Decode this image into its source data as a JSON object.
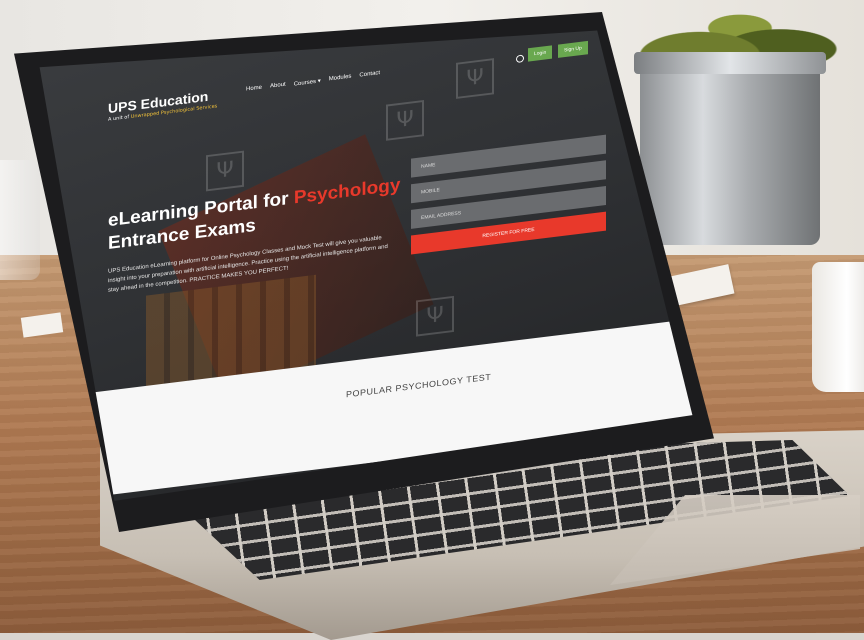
{
  "brand": {
    "title": "UPS Education",
    "sub_prefix": "A unit of",
    "sub_accent": "Unwrapped Psychological Services"
  },
  "nav": {
    "items": [
      "Home",
      "About",
      "Courses ▾",
      "Modules",
      "Contact"
    ]
  },
  "header_buttons": {
    "login": "Login",
    "signup": "Sign Up"
  },
  "hero": {
    "title_prefix": "eLearning Portal for",
    "title_accent": "Psychology",
    "title_line2": "Entrance Exams",
    "description": "UPS Education eLearning platform for Online Psychology Classes and Mock Test will give you valuable insight into your preparation with artificial intelligence. Practice using the artificial intelligence platform and stay ahead in the competition. PRACTICE MAKES YOU PERFECT!"
  },
  "form": {
    "name_placeholder": "NAME",
    "mobile_placeholder": "MOBILE",
    "email_placeholder": "EMAIL ADDRESS",
    "submit_label": "REGISTER FOR FREE"
  },
  "section": {
    "popular_title": "POPULAR PSYCHOLOGY TEST"
  },
  "colors": {
    "accent_red": "#e8392b",
    "accent_green": "#69a84f",
    "brand_yellow": "#f2c23a"
  }
}
